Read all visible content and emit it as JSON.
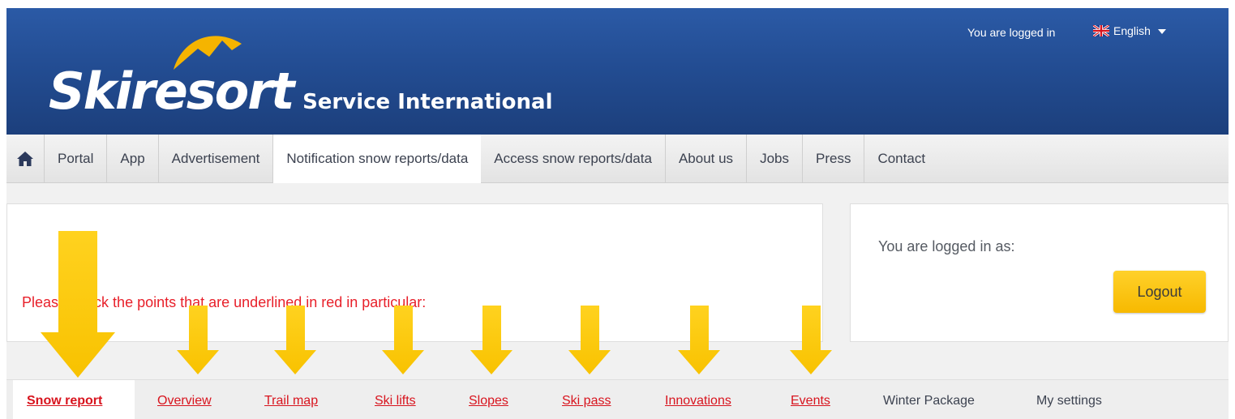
{
  "header": {
    "logo_main": "Skiresort",
    "logo_sub": "Service International",
    "logged_in_status": "You are logged in",
    "language": "English"
  },
  "nav": {
    "home_icon": "home-icon",
    "items": [
      {
        "label": "Portal"
      },
      {
        "label": "App"
      },
      {
        "label": "Advertisement"
      },
      {
        "label": "Notification snow reports/data",
        "active": true
      },
      {
        "label": "Access snow reports/data"
      },
      {
        "label": "About us"
      },
      {
        "label": "Jobs"
      },
      {
        "label": "Press"
      },
      {
        "label": "Contact"
      }
    ]
  },
  "notice": {
    "text": "Please check the points that are underlined in red in particular:"
  },
  "login": {
    "label": "You are logged in as:",
    "logout_label": "Logout"
  },
  "subtabs": [
    {
      "label": "Snow report",
      "style": "red",
      "active": true
    },
    {
      "label": "Overview",
      "style": "red"
    },
    {
      "label": "Trail map",
      "style": "red"
    },
    {
      "label": "Ski lifts",
      "style": "red"
    },
    {
      "label": "Slopes",
      "style": "red"
    },
    {
      "label": "Ski pass",
      "style": "red"
    },
    {
      "label": "Innovations",
      "style": "red"
    },
    {
      "label": "Events",
      "style": "red"
    },
    {
      "label": "Winter Package",
      "style": "gray"
    },
    {
      "label": "My settings",
      "style": "gray"
    }
  ],
  "colors": {
    "header_blue": "#234d93",
    "accent_red": "#d8141e",
    "logout_yellow": "#f7b900",
    "arrow_yellow": "#ffc800"
  }
}
